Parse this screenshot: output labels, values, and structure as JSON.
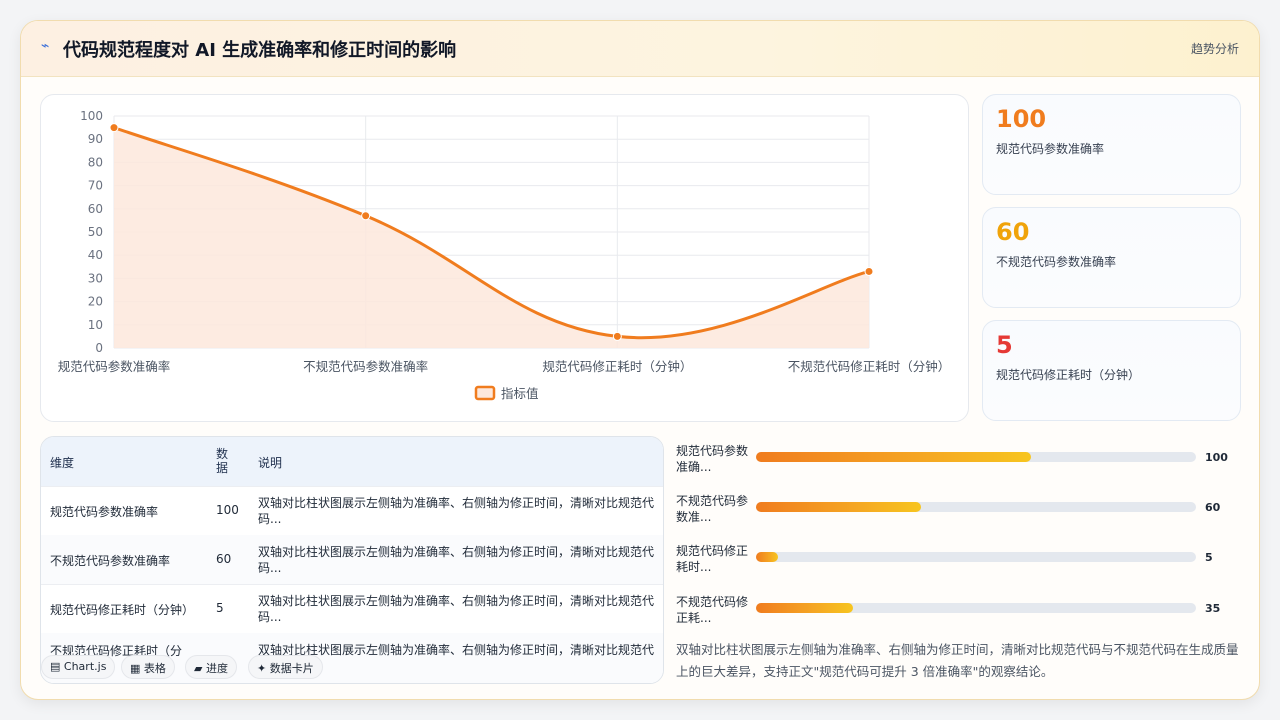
{
  "header": {
    "title": "代码规范程度对 AI 生成准确率和修正时间的影响",
    "badge": "趋势分析"
  },
  "chart_data": {
    "type": "area",
    "categories": [
      "规范代码参数准确率",
      "不规范代码参数准确率",
      "规范代码修正耗时（分钟）",
      "不规范代码修正耗时（分钟）"
    ],
    "series": [
      {
        "name": "指标值",
        "values": [
          95,
          57,
          5,
          33
        ]
      }
    ],
    "ylim": [
      0,
      100
    ],
    "yticks": [
      0,
      10,
      20,
      30,
      40,
      50,
      60,
      70,
      80,
      90,
      100
    ],
    "grid": true,
    "legend": "bottom",
    "colors": {
      "line": "#f07c1e",
      "fill": "#fde8dc"
    }
  },
  "stats": [
    {
      "value": "100",
      "label": "规范代码参数准确率",
      "color": "#f07c1e"
    },
    {
      "value": "60",
      "label": "不规范代码参数准确率",
      "color": "#f0a30a"
    },
    {
      "value": "5",
      "label": "规范代码修正耗时（分钟）",
      "color": "#e53935"
    }
  ],
  "table": {
    "headers": [
      "维度",
      "数据",
      "说明"
    ],
    "rows": [
      {
        "dim": "规范代码参数准确率",
        "val": "100",
        "desc": "双轴对比柱状图展示左侧轴为准确率、右侧轴为修正时间，清晰对比规范代码..."
      },
      {
        "dim": "不规范代码参数准确率",
        "val": "60",
        "desc": "双轴对比柱状图展示左侧轴为准确率、右侧轴为修正时间，清晰对比规范代码..."
      },
      {
        "dim": "规范代码修正耗时（分钟）",
        "val": "5",
        "desc": "双轴对比柱状图展示左侧轴为准确率、右侧轴为修正时间，清晰对比规范代码..."
      },
      {
        "dim": "不规范代码修正耗时（分",
        "val": "",
        "desc": "双轴对比柱状图展示左侧轴为准确率、右侧轴为修正时间，清晰对比规范代"
      }
    ]
  },
  "tabs": [
    {
      "icon": "▤",
      "label": "Chart.js"
    },
    {
      "icon": "▦",
      "label": "表格"
    },
    {
      "icon": "▰",
      "label": "进度"
    },
    {
      "icon": "✦",
      "label": "数据卡片"
    }
  ],
  "progress": [
    {
      "label": "规范代码参数准确...",
      "value": "100",
      "fraction": 0.625
    },
    {
      "label": "不规范代码参数准...",
      "value": "60",
      "fraction": 0.375
    },
    {
      "label": "规范代码修正耗时...",
      "value": "5",
      "fraction": 0.05
    },
    {
      "label": "不规范代码修正耗...",
      "value": "35",
      "fraction": 0.22
    }
  ],
  "note": "双轴对比柱状图展示左侧轴为准确率、右侧轴为修正时间，清晰对比规范代码与不规范代码在生成质量上的巨大差异，支持正文\"规范代码可提升 3 倍准确率\"的观察结论。"
}
